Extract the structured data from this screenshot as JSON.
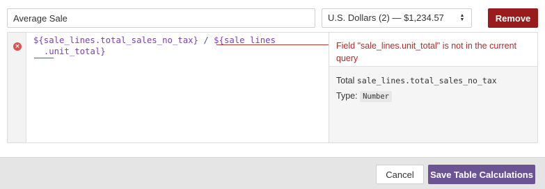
{
  "calculation": {
    "name": "Average Sale",
    "name_placeholder": "Calculation name"
  },
  "format": {
    "selected": "U.S. Dollars (2) — $1,234.57",
    "arrows_up": "▲",
    "arrows_down": "▼"
  },
  "actions": {
    "remove_label": "Remove",
    "cancel_label": "Cancel",
    "save_label": "Save Table Calculations"
  },
  "editor": {
    "error_icon": "×",
    "line1_part1": "${sale_lines.total_sales_no_tax}",
    "line1_op": " / ",
    "line1_part2": "${sale_lines",
    "line2": ".unit_total}"
  },
  "side_panel": {
    "error_message": "Field \"sale_lines.unit_total\" is not in the current query",
    "field_prefix": "Total",
    "field_name": "sale_lines.total_sales_no_tax",
    "type_label": "Type:",
    "type_value": "Number"
  },
  "colors": {
    "remove_bg": "#9a1b1b",
    "save_bg": "#6c5494",
    "error_text": "#b22a2a",
    "code_field": "#7a3fb5"
  }
}
